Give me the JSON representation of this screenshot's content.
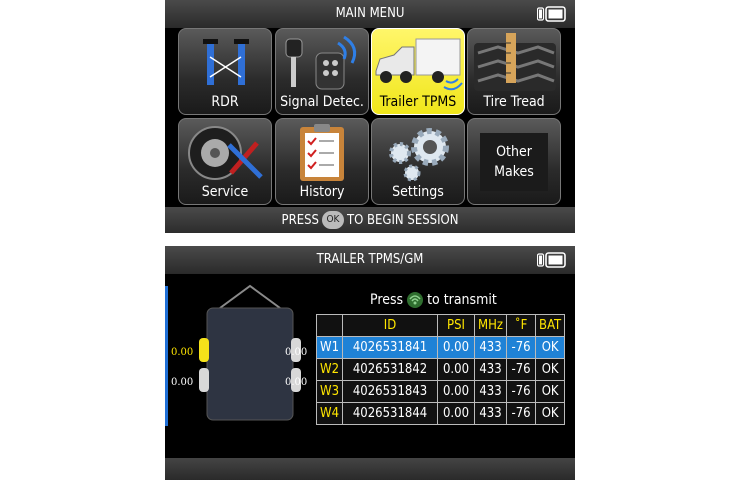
{
  "main_menu": {
    "title": "MAIN MENU",
    "tiles": [
      {
        "label": "RDR",
        "icon": "rdr-icon"
      },
      {
        "label": "Signal Detec.",
        "icon": "key-fob-icon"
      },
      {
        "label": "Trailer TPMS",
        "icon": "truck-trailer-icon",
        "selected": true
      },
      {
        "label": "Tire Tread",
        "icon": "tire-tread-icon"
      },
      {
        "label": "Service",
        "icon": "tire-tools-icon"
      },
      {
        "label": "History",
        "icon": "clipboard-icon"
      },
      {
        "label": "Settings",
        "icon": "gears-icon"
      },
      {
        "label_line1": "Other",
        "label_line2": "Makes"
      }
    ],
    "footer_prefix": "PRESS",
    "footer_button": "OK",
    "footer_suffix": "TO BEGIN SESSION"
  },
  "trailer_screen": {
    "title": "TRAILER TPMS/GM",
    "press_prefix": "Press",
    "press_suffix": "to transmit",
    "table_headers": [
      "",
      "ID",
      "PSI",
      "MHz",
      "˚F",
      "BAT"
    ],
    "rows": [
      {
        "wheel": "W1",
        "id": "4026531841",
        "psi": "0.00",
        "mhz": "433",
        "temp": "-76",
        "bat": "OK",
        "selected": true
      },
      {
        "wheel": "W2",
        "id": "4026531842",
        "psi": "0.00",
        "mhz": "433",
        "temp": "-76",
        "bat": "OK"
      },
      {
        "wheel": "W3",
        "id": "4026531843",
        "psi": "0.00",
        "mhz": "433",
        "temp": "-76",
        "bat": "OK"
      },
      {
        "wheel": "W4",
        "id": "4026531844",
        "psi": "0.00",
        "mhz": "433",
        "temp": "-76",
        "bat": "OK"
      }
    ],
    "diagram_pressures": {
      "front_left": "0.00",
      "front_right": "0.00",
      "rear_left": "0.00",
      "rear_right": "0.00"
    }
  },
  "colors": {
    "accent_yellow": "#ffe600",
    "selection_blue": "#1f82d6",
    "selected_tile": "#f5ea2a"
  }
}
